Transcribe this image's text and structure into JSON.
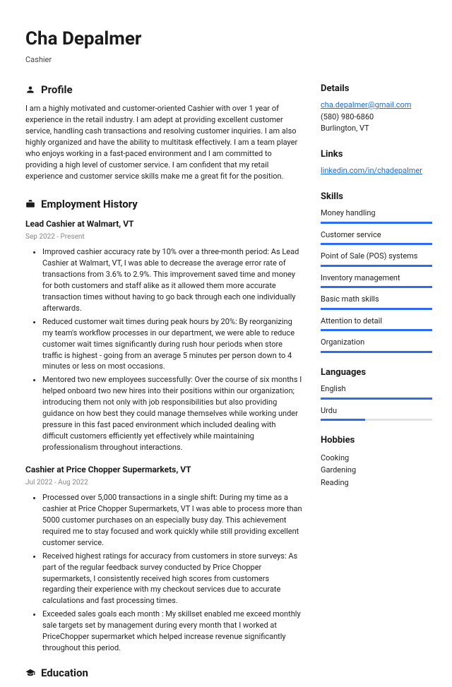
{
  "header": {
    "name": "Cha Depalmer",
    "title": "Cashier"
  },
  "profile": {
    "heading": "Profile",
    "text": "I am a highly motivated and customer-oriented Cashier with over 1 year of experience in the retail industry. I am adept at providing excellent customer service, handling cash transactions and resolving customer inquiries. I am also highly organized and have the ability to multitask effectively. I am a team player who enjoys working in a fast-paced environment and I am committed to providing a high level of customer service. I am confident that my retail experience and customer service skills make me a great fit for the position."
  },
  "employment": {
    "heading": "Employment History",
    "jobs": [
      {
        "title": "Lead Cashier at Walmart, VT",
        "dates": "Sep 2022 - Present",
        "bullets": [
          "Improved cashier accuracy rate by 10% over a three-month period: As Lead Cashier at Walmart, VT, I was able to decrease the average error rate of transactions from 3.6% to 2.9%. This improvement saved time and money for both customers and staff alike as it allowed them more accurate transaction times without having to go back through each one individually afterwards.",
          "Reduced customer wait times during peak hours by 20%: By reorganizing my team's workflow processes in our department, we were able to reduce customer wait times significantly during rush hour periods when store traffic is highest - going from an average 5 minutes per person down to 4 minutes or less on most occasions.",
          "Mentored two new employees successfully: Over the course of six months I helped onboard two new hires into their positions within our organization; introducing them not only with job responsibilities but also providing guidance on how best they could manage themselves while working under pressure in this fast paced environment which included dealing with difficult customers efficiently yet effectively while maintaining professionalism throughout interactions."
        ]
      },
      {
        "title": "Cashier at Price Chopper Supermarkets, VT",
        "dates": "Jul 2022 - Aug 2022",
        "bullets": [
          "Processed over 5,000 transactions in a single shift: During my time as a cashier at Price Chopper Supermarkets, VT I was able to process more than 5000 customer purchases on an especially busy day. This achievement required me to stay focused and work quickly while still providing excellent customer service.",
          "Received highest ratings for accuracy from customers in store surveys: As part of the regular feedback survey conducted by Price Chopper supermarkets, I consistently received high scores from customers regarding their experience with my checkout services due to accurate calculations and fast processing times.",
          "Exceeded sales goals each month : My skillset enabled me exceed monthly sale targets set by management during every month that I worked at PriceChopper supermarket which helped increase revenue significantly throughout this period."
        ]
      }
    ]
  },
  "education": {
    "heading": "Education"
  },
  "details": {
    "heading": "Details",
    "email": "cha.depalmer@gmail.com",
    "phone": "(580) 980-6860",
    "location": "Burlington, VT"
  },
  "links": {
    "heading": "Links",
    "items": [
      "linkedin.com/in/chadepalmer"
    ]
  },
  "skills": {
    "heading": "Skills",
    "items": [
      {
        "name": "Money handling",
        "pct": 100
      },
      {
        "name": "Customer service",
        "pct": 100
      },
      {
        "name": "Point of Sale (POS) systems",
        "pct": 100
      },
      {
        "name": "Inventory management",
        "pct": 100
      },
      {
        "name": "Basic math skills",
        "pct": 100
      },
      {
        "name": "Attention to detail",
        "pct": 100
      },
      {
        "name": "Organization",
        "pct": 100
      }
    ]
  },
  "languages": {
    "heading": "Languages",
    "items": [
      {
        "name": "English",
        "pct": 100
      },
      {
        "name": "Urdu",
        "pct": 40
      }
    ]
  },
  "hobbies": {
    "heading": "Hobbies",
    "items": [
      "Cooking",
      "Gardening",
      "Reading"
    ]
  }
}
